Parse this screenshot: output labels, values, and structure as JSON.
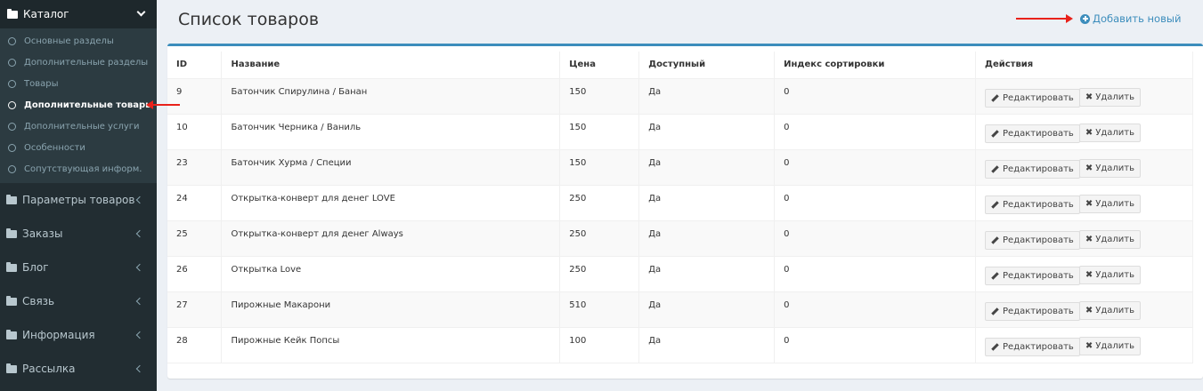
{
  "sidebar": {
    "catalog_label": "Каталог",
    "submenu": [
      {
        "label": "Основные разделы",
        "active": false
      },
      {
        "label": "Дополнительные разделы",
        "active": false
      },
      {
        "label": "Товары",
        "active": false
      },
      {
        "label": "Дополнительные товары",
        "active": true
      },
      {
        "label": "Дополнительные услуги",
        "active": false
      },
      {
        "label": "Особенности",
        "active": false
      },
      {
        "label": "Сопутствующая информ.",
        "active": false
      }
    ],
    "menu": [
      {
        "label": "Параметры товаров"
      },
      {
        "label": "Заказы"
      },
      {
        "label": "Блог"
      },
      {
        "label": "Связь"
      },
      {
        "label": "Информация"
      },
      {
        "label": "Рассылка"
      }
    ]
  },
  "header": {
    "title": "Список товаров",
    "add_new_label": "Добавить новый"
  },
  "table": {
    "columns": [
      "ID",
      "Название",
      "Цена",
      "Доступный",
      "Индекс сортировки",
      "Действия"
    ],
    "rows": [
      {
        "id": "9",
        "name": "Батончик Спирулина / Банан",
        "price": "150",
        "available": "Да",
        "sort": "0"
      },
      {
        "id": "10",
        "name": "Батончик Черника / Ваниль",
        "price": "150",
        "available": "Да",
        "sort": "0"
      },
      {
        "id": "23",
        "name": "Батончик Хурма / Специи",
        "price": "150",
        "available": "Да",
        "sort": "0"
      },
      {
        "id": "24",
        "name": "Открытка-конверт для денег LOVE",
        "price": "250",
        "available": "Да",
        "sort": "0"
      },
      {
        "id": "25",
        "name": "Открытка-конверт для денег Always",
        "price": "250",
        "available": "Да",
        "sort": "0"
      },
      {
        "id": "26",
        "name": "Открытка Love",
        "price": "250",
        "available": "Да",
        "sort": "0"
      },
      {
        "id": "27",
        "name": "Пирожные Макарони",
        "price": "510",
        "available": "Да",
        "sort": "0"
      },
      {
        "id": "28",
        "name": "Пирожные Кейк Попсы",
        "price": "100",
        "available": "Да",
        "sort": "0"
      }
    ],
    "edit_label": "Редактировать",
    "delete_label": "Удалить"
  },
  "colors": {
    "sidebar_bg": "#222d32",
    "accent": "#3c8dbc",
    "annotation_arrow": "#e8211a"
  }
}
